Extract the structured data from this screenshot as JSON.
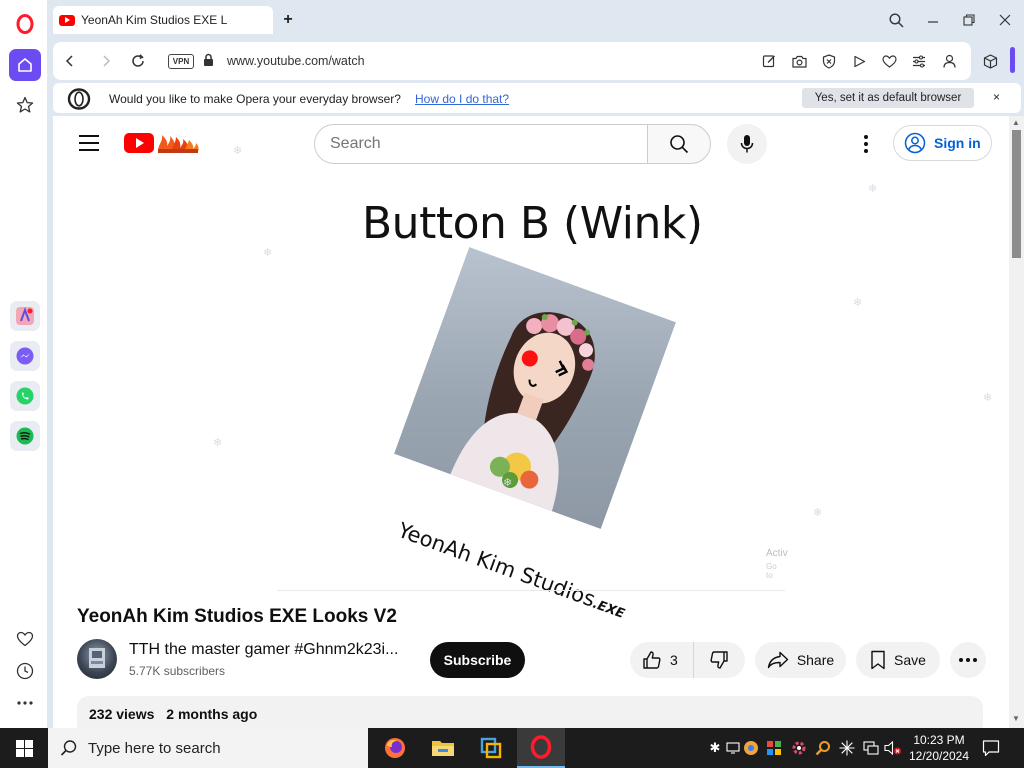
{
  "browser": {
    "tab_title": "YeonAh Kim Studios EXE L",
    "new_tab_label": "+",
    "url": "www.youtube.com/watch",
    "vpn_label": "VPN"
  },
  "notice": {
    "text": "Would you like to make Opera your everyday browser?",
    "link": "How do I do that?",
    "button": "Yes, set it as default browser",
    "close": "×"
  },
  "youtube": {
    "search_placeholder": "Search",
    "sign_in": "Sign in"
  },
  "video": {
    "overlay_title": "Button B (Wink)",
    "watermark_main": "YeonAh Kim Studios",
    "watermark_suffix": ".EXE",
    "activate_line1": "Activ",
    "activate_line2": "Go to"
  },
  "details": {
    "title": "YeonAh Kim Studios EXE Looks V2",
    "channel_name": "TTH the master gamer #Ghnm2k23i...",
    "subscribers": "5.77K subscribers",
    "subscribe": "Subscribe",
    "likes": "3",
    "share": "Share",
    "save": "Save",
    "views": "232 views",
    "age": "2 months ago"
  },
  "taskbar": {
    "search_placeholder": "Type here to search",
    "time": "10:23 PM",
    "date": "12/20/2024"
  },
  "colors": {
    "opera_red": "#ff1b2d",
    "opera_violet": "#6c4bf3",
    "youtube_red": "#ff0000",
    "signin_blue": "#065fd4"
  }
}
